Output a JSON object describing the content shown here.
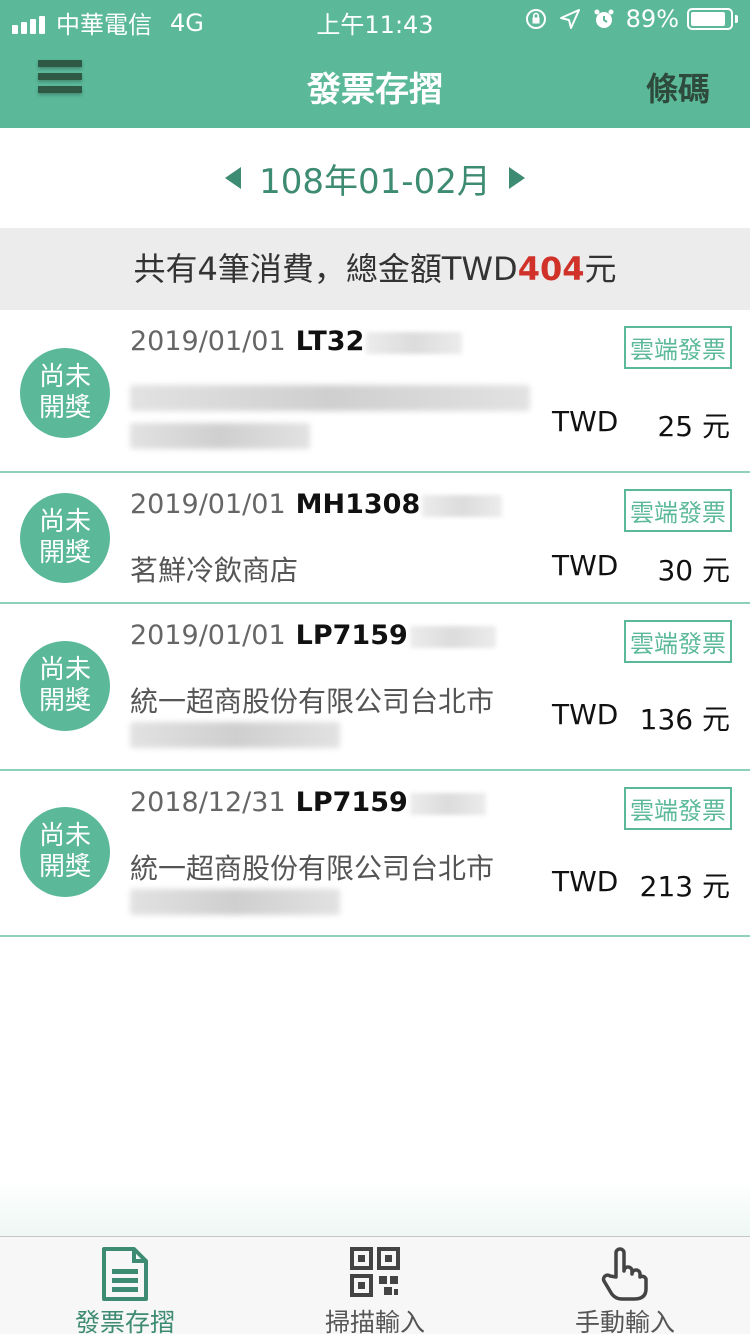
{
  "status_bar": {
    "carrier": "中華電信",
    "network": "4G",
    "time": "上午11:43",
    "battery": "89%",
    "battery_level": 0.89
  },
  "header": {
    "title": "發票存摺",
    "right_button": "條碼",
    "color": "#5bb99a"
  },
  "period": {
    "label": "108年01-02月"
  },
  "summary": {
    "prefix": "共有4筆消費，總金額TWD",
    "total": "404",
    "suffix": "元",
    "total_color": "#d0322a"
  },
  "invoices": [
    {
      "prize_line1": "尚未",
      "prize_line2": "開獎",
      "date": "2019/01/01",
      "number": "LT32",
      "tag": "雲端發票",
      "store": "",
      "currency": "TWD",
      "amount": "25 元"
    },
    {
      "prize_line1": "尚未",
      "prize_line2": "開獎",
      "date": "2019/01/01",
      "number": "MH1308",
      "tag": "雲端發票",
      "store": "茗鮮冷飲商店",
      "currency": "TWD",
      "amount": "30 元"
    },
    {
      "prize_line1": "尚未",
      "prize_line2": "開獎",
      "date": "2019/01/01",
      "number": "LP7159",
      "tag": "雲端發票",
      "store": "統一超商股份有限公司台北市",
      "currency": "TWD",
      "amount": "136 元"
    },
    {
      "prize_line1": "尚未",
      "prize_line2": "開獎",
      "date": "2018/12/31",
      "number": "LP7159",
      "tag": "雲端發票",
      "store": "統一超商股份有限公司台北市",
      "currency": "TWD",
      "amount": "213 元"
    }
  ],
  "tab_bar": {
    "tabs": [
      {
        "label": "發票存摺",
        "icon": "document-icon",
        "active": true
      },
      {
        "label": "掃描輸入",
        "icon": "qr-code-icon",
        "active": false
      },
      {
        "label": "手動輸入",
        "icon": "hand-pointer-icon",
        "active": false
      }
    ]
  }
}
